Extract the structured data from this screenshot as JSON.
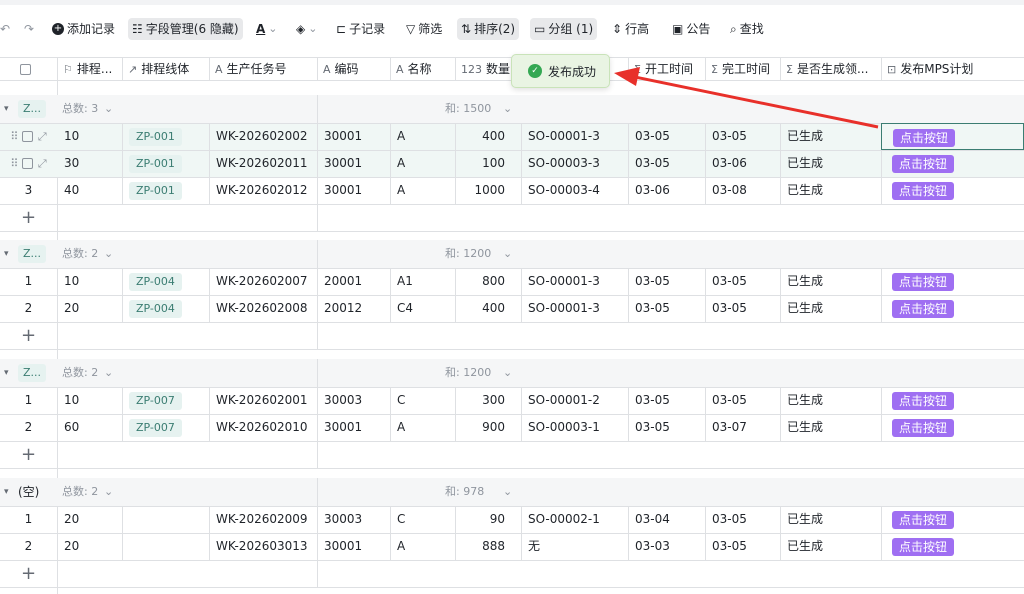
{
  "toolbar": {
    "undo": "↶",
    "redo": "↷",
    "add_record": "添加记录",
    "field_manage": "字段管理(6 隐藏)",
    "sub_record": "子记录",
    "filter": "筛选",
    "sort": "排序(2)",
    "group": "分组 (1)",
    "row_height": "行高",
    "notice": "公告",
    "search": "查找"
  },
  "columns": [
    {
      "icon": "⚐",
      "label": "排程..."
    },
    {
      "icon": "↗",
      "label": "排程线体"
    },
    {
      "icon": "A",
      "label": "生产任务号"
    },
    {
      "icon": "A",
      "label": "编码"
    },
    {
      "icon": "A",
      "label": "名称"
    },
    {
      "icon": "123",
      "label": "数量"
    },
    {
      "icon": "",
      "label": "次"
    },
    {
      "icon": "Σ",
      "label": "开工时间"
    },
    {
      "icon": "Σ",
      "label": "完工时间"
    },
    {
      "icon": "Σ",
      "label": "是否生成领..."
    },
    {
      "icon": "⊡",
      "label": "发布MPS计划"
    }
  ],
  "toast": "发布成功",
  "groups": [
    {
      "name": "Z...",
      "count_label": "总数: 3",
      "sum_label": "和: 1500",
      "rows": [
        {
          "idx": "",
          "prio": "10",
          "line": "ZP-001",
          "task": "WK-202602002",
          "code": "30001",
          "name": "A",
          "qty": "400",
          "so": "SO-00001-3",
          "start": "03-05",
          "end": "03-05",
          "gen": "已生成",
          "btn": "点击按钮"
        },
        {
          "idx": "",
          "prio": "30",
          "line": "ZP-001",
          "task": "WK-202602011",
          "code": "30001",
          "name": "A",
          "qty": "100",
          "so": "SO-00003-3",
          "start": "03-05",
          "end": "03-06",
          "gen": "已生成",
          "btn": "点击按钮"
        },
        {
          "idx": "3",
          "prio": "40",
          "line": "ZP-001",
          "task": "WK-202602012",
          "code": "30001",
          "name": "A",
          "qty": "1000",
          "so": "SO-00003-4",
          "start": "03-06",
          "end": "03-08",
          "gen": "已生成",
          "btn": "点击按钮"
        }
      ]
    },
    {
      "name": "Z...",
      "count_label": "总数: 2",
      "sum_label": "和: 1200",
      "rows": [
        {
          "idx": "1",
          "prio": "10",
          "line": "ZP-004",
          "task": "WK-202602007",
          "code": "20001",
          "name": "A1",
          "qty": "800",
          "so": "SO-00001-3",
          "start": "03-05",
          "end": "03-05",
          "gen": "已生成",
          "btn": "点击按钮"
        },
        {
          "idx": "2",
          "prio": "20",
          "line": "ZP-004",
          "task": "WK-202602008",
          "code": "20012",
          "name": "C4",
          "qty": "400",
          "so": "SO-00001-3",
          "start": "03-05",
          "end": "03-05",
          "gen": "已生成",
          "btn": "点击按钮"
        }
      ]
    },
    {
      "name": "Z...",
      "count_label": "总数: 2",
      "sum_label": "和: 1200",
      "rows": [
        {
          "idx": "1",
          "prio": "10",
          "line": "ZP-007",
          "task": "WK-202602001",
          "code": "30003",
          "name": "C",
          "qty": "300",
          "so": "SO-00001-2",
          "start": "03-05",
          "end": "03-05",
          "gen": "已生成",
          "btn": "点击按钮"
        },
        {
          "idx": "2",
          "prio": "60",
          "line": "ZP-007",
          "task": "WK-202602010",
          "code": "30001",
          "name": "A",
          "qty": "900",
          "so": "SO-00003-1",
          "start": "03-05",
          "end": "03-07",
          "gen": "已生成",
          "btn": "点击按钮"
        }
      ]
    },
    {
      "name": "(空)",
      "count_label": "总数: 2",
      "sum_label": "和: 978",
      "rows": [
        {
          "idx": "1",
          "prio": "20",
          "line": "",
          "task": "WK-202602009",
          "code": "30003",
          "name": "C",
          "qty": "90",
          "so": "SO-00002-1",
          "start": "03-04",
          "end": "03-05",
          "gen": "已生成",
          "btn": "点击按钮"
        },
        {
          "idx": "2",
          "prio": "20",
          "line": "",
          "task": "WK-202603013",
          "code": "30001",
          "name": "A",
          "qty": "888",
          "so": "无",
          "start": "03-03",
          "end": "03-05",
          "gen": "已生成",
          "btn": "点击按钮"
        }
      ]
    }
  ],
  "add_row": "+",
  "colors": {
    "accent": "#9f6ff2",
    "tag_bg": "#e6f2f0",
    "arrow": "#e8302a",
    "toast_bg": "#e9f4e3"
  }
}
